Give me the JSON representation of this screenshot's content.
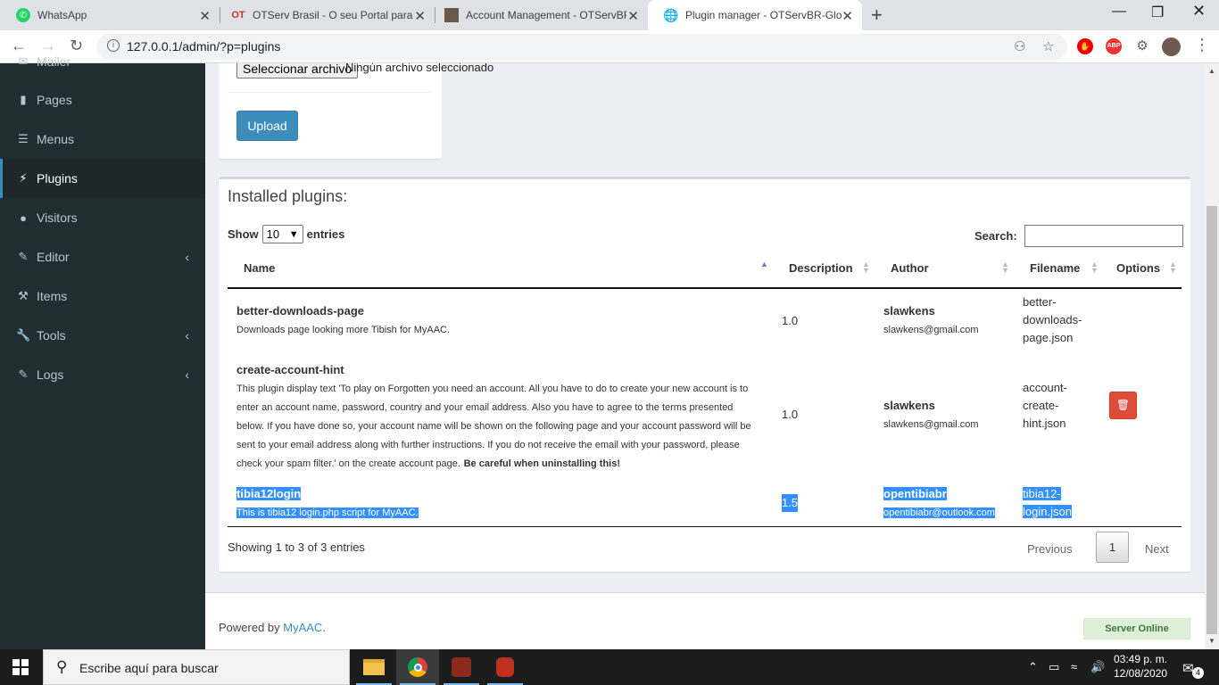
{
  "browser": {
    "tabs": [
      {
        "title": "WhatsApp",
        "icon": "whatsapp-icon"
      },
      {
        "title": "OTServ Brasil - O seu Portal para",
        "icon": "otserv-icon",
        "favicon_text": "OT"
      },
      {
        "title": "Account Management - OTServBR",
        "icon": "page-icon"
      },
      {
        "title": "Plugin manager - OTServBR-Glob",
        "icon": "globe-icon"
      }
    ],
    "url": "127.0.0.1/admin/?p=plugins",
    "ext_abp": "ABP"
  },
  "sidebar": {
    "items": [
      {
        "label": "Mailer",
        "icon": "envelope-icon"
      },
      {
        "label": "Pages",
        "icon": "book-icon"
      },
      {
        "label": "Menus",
        "icon": "list-icon"
      },
      {
        "label": "Plugins",
        "icon": "plug-icon"
      },
      {
        "label": "Visitors",
        "icon": "user-icon"
      },
      {
        "label": "Editor",
        "icon": "edit-icon"
      },
      {
        "label": "Items",
        "icon": "hammer-icon"
      },
      {
        "label": "Tools",
        "icon": "wrench-icon"
      },
      {
        "label": "Logs",
        "icon": "edit-icon"
      }
    ]
  },
  "upload": {
    "file_button": "Seleccionar archivo",
    "file_status": "Ningún archivo seleccionado",
    "upload_label": "Upload"
  },
  "plugins": {
    "title": "Installed plugins:",
    "show_label": "Show",
    "entries_value": "10",
    "entries_label": "entries",
    "search_label": "Search:",
    "columns": [
      "Name",
      "Description",
      "Author",
      "Filename",
      "Options"
    ],
    "rows": [
      {
        "name": "better-downloads-page",
        "description": "Downloads page looking more Tibish for MyAAC.",
        "version": "1.0",
        "author": "slawkens",
        "email": "slawkens@gmail.com",
        "filename": [
          "better-",
          "downloads-",
          "page.json"
        ]
      },
      {
        "name": "create-account-hint",
        "description_lines": [
          "This plugin display text 'To play on Forgotten you need an account. All you have to do to create your new account is to",
          "enter an account name, password, country and your email address. Also you have to agree to the terms presented",
          "below. If you have done so, your account name will be shown on the following page and your account password will be",
          "sent to your email address along with further instructions. If you do not receive the email with your password, please",
          "check your spam filter.' on the create account page."
        ],
        "description_warning": "Be careful when uninstalling this!",
        "version": "1.0",
        "author": "slawkens",
        "email": "slawkens@gmail.com",
        "filename": [
          "account-",
          "create-",
          "hint.json"
        ]
      },
      {
        "name": "tibia12login",
        "description": "This is tibia12 login.php script for MyAAC.",
        "version": "1.5",
        "author": "opentibiabr",
        "email": "opentibiabr@outlook.com",
        "filename": [
          "tibia12-",
          "login.json"
        ]
      }
    ],
    "showing": "Showing 1 to 3 of 3 entries",
    "previous": "Previous",
    "page": "1",
    "next": "Next"
  },
  "footer": {
    "powered_prefix": "Powered by ",
    "powered_link": "MyAAC",
    "powered_suffix": ".",
    "server_status": "Server Online"
  },
  "taskbar": {
    "search_placeholder": "Escribe aquí para buscar",
    "time": "03:49 p. m.",
    "date": "12/08/2020",
    "notifications": "4"
  },
  "colors": {
    "sidebar_bg": "#222d32",
    "accent": "#3c8dbc",
    "danger": "#dd4b39",
    "selection": "#3390ff"
  }
}
